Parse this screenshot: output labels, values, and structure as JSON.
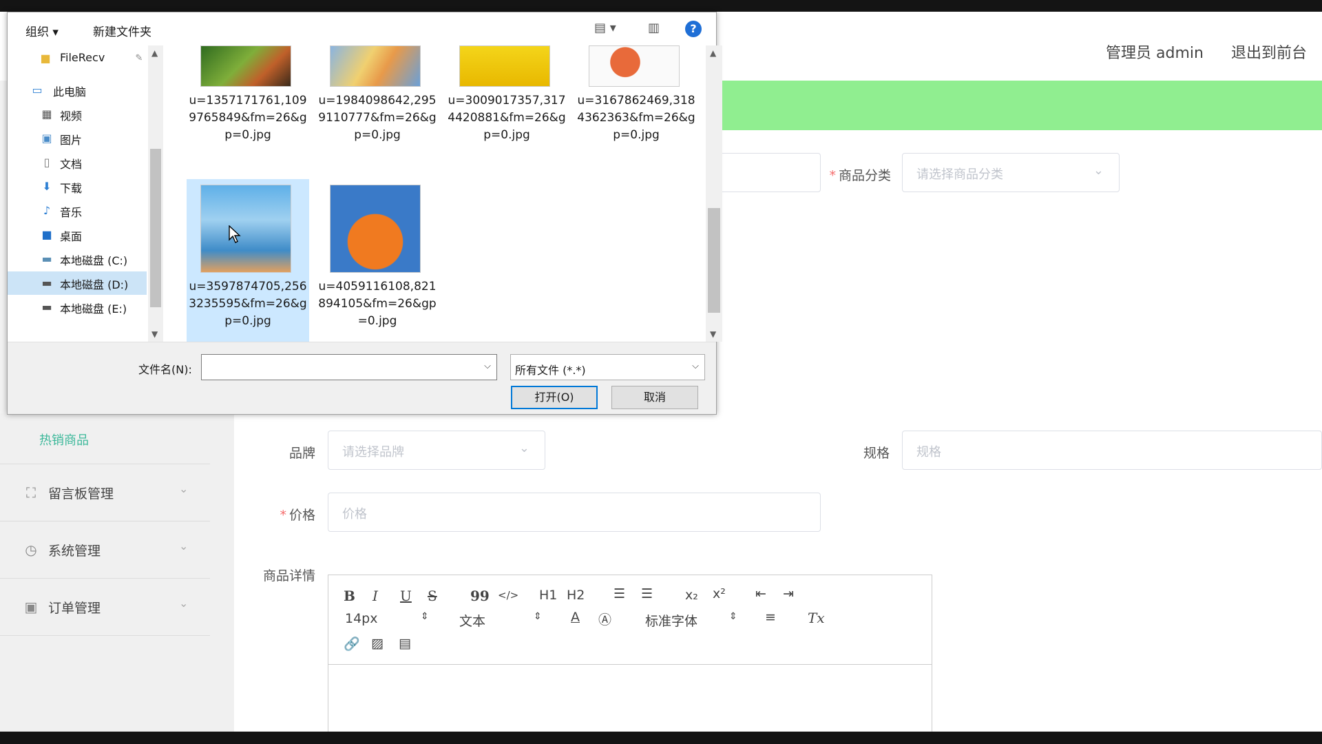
{
  "header": {
    "user": "管理员 admin",
    "logout": "退出到前台"
  },
  "form": {
    "category_label": "商品分类",
    "category_placeholder": "请选择商品分类",
    "brand_label": "品牌",
    "brand_placeholder": "请选择品牌",
    "spec_label": "规格",
    "spec_placeholder": "规格",
    "price_label": "价格",
    "price_placeholder": "价格",
    "detail_label": "商品详情"
  },
  "sidebar": {
    "sub_item": "热销商品",
    "items": [
      {
        "label": "留言板管理",
        "icon": "fullscreen-icon"
      },
      {
        "label": "系统管理",
        "icon": "clock-icon"
      },
      {
        "label": "订单管理",
        "icon": "clipboard-icon"
      }
    ]
  },
  "editor": {
    "font_size": "14px",
    "paragraph": "文本",
    "font_family": "标准字体",
    "bold": "B",
    "italic": "I",
    "underline": "U",
    "strike": "S",
    "quote": "99",
    "code": "</>",
    "h1": "H1",
    "h2": "H2",
    "sub": "x₂",
    "sup": "x²",
    "clear": "Tx"
  },
  "dialog": {
    "organize": "组织",
    "new_folder": "新建文件夹",
    "help": "?",
    "nav": [
      {
        "label": "FileRecv",
        "icon": "folder-icon"
      },
      {
        "label": "此电脑",
        "icon": "computer-icon"
      },
      {
        "label": "视频",
        "icon": "video-icon"
      },
      {
        "label": "图片",
        "icon": "picture-icon"
      },
      {
        "label": "文档",
        "icon": "document-icon"
      },
      {
        "label": "下载",
        "icon": "download-icon"
      },
      {
        "label": "音乐",
        "icon": "music-icon"
      },
      {
        "label": "桌面",
        "icon": "desktop-icon"
      },
      {
        "label": "本地磁盘 (C:)",
        "icon": "drive-icon"
      },
      {
        "label": "本地磁盘 (D:)",
        "icon": "drive-icon"
      },
      {
        "label": "本地磁盘 (E:)",
        "icon": "drive-icon"
      }
    ],
    "files": [
      "u=1357171761,1099765849&fm=26&gp=0.jpg",
      "u=1984098642,2959110777&fm=26&gp=0.jpg",
      "u=3009017357,3174420881&fm=26&gp=0.jpg",
      "u=3167862469,3184362363&fm=26&gp=0.jpg",
      "u=3597874705,2563235595&fm=26&gp=0.jpg",
      "u=4059116108,821894105&fm=26&gp=0.jpg"
    ],
    "filename_label": "文件名(N):",
    "filename_value": "",
    "filetype": "所有文件 (*.*)",
    "open": "打开(O)",
    "cancel": "取消"
  },
  "colors": {
    "accent_green": "#90ee90",
    "teal_text": "#3cb89a",
    "required": "#f56c6c",
    "win_blue": "#0078d7"
  }
}
